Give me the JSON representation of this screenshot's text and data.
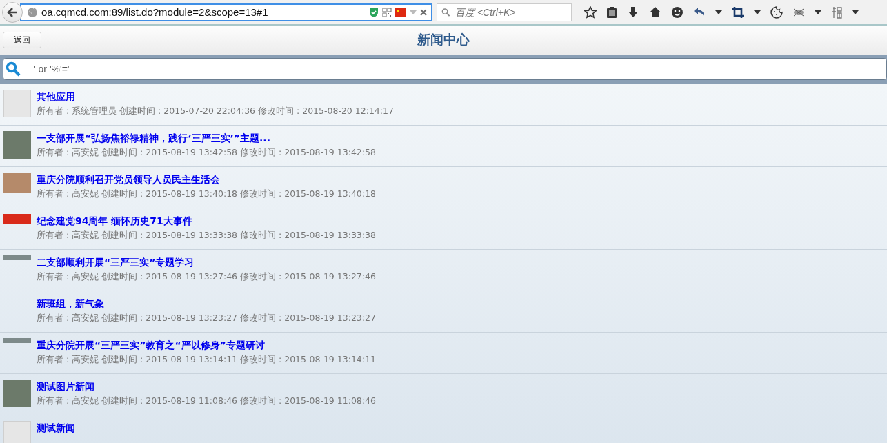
{
  "browser": {
    "url": "oa.cqmcd.com:89/list.do?module=2&scope=13#1",
    "search_placeholder": "百度 <Ctrl+K>"
  },
  "header": {
    "back_button": "返回",
    "title": "新闻中心"
  },
  "search": {
    "value": "—' or '%'='"
  },
  "news": [
    {
      "title": "其他应用",
      "meta": "所有者 : 系统管理员 创建时间 : 2015-07-20 22:04:36 修改时间 : 2015-08-20 12:14:17",
      "kind": "placeholder"
    },
    {
      "title": "一支部开展“弘扬焦裕禄精神，践行‘三严三实’”主题...",
      "meta": "所有者 : 高安妮 创建时间 : 2015-08-19 13:42:58 修改时间 : 2015-08-19 13:42:58",
      "kind": "tall"
    },
    {
      "title": "重庆分院顺利召开党员领导人员民主生活会",
      "meta": "所有者 : 高安妮 创建时间 : 2015-08-19 13:40:18 修改时间 : 2015-08-19 13:40:18",
      "kind": "medium"
    },
    {
      "title": "纪念建党94周年 缅怀历史71大事件",
      "meta": "所有者 : 高安妮 创建时间 : 2015-08-19 13:33:38 修改时间 : 2015-08-19 13:33:38",
      "kind": "banner"
    },
    {
      "title": "二支部顺利开展“三严三实”专题学习",
      "meta": "所有者 : 高安妮 创建时间 : 2015-08-19 13:27:46 修改时间 : 2015-08-19 13:27:46",
      "kind": "strip"
    },
    {
      "title": "新班组，新气象",
      "meta": "所有者 : 高安妮 创建时间 : 2015-08-19 13:23:27 修改时间 : 2015-08-19 13:23:27",
      "kind": "none"
    },
    {
      "title": "重庆分院开展“三严三实”教育之“严以修身”专题研讨",
      "meta": "所有者 : 高安妮 创建时间 : 2015-08-19 13:14:11 修改时间 : 2015-08-19 13:14:11",
      "kind": "strip"
    },
    {
      "title": "测试图片新闻",
      "meta": "所有者 : 高安妮 创建时间 : 2015-08-19 11:08:46 修改时间 : 2015-08-19 11:08:46",
      "kind": "tall"
    },
    {
      "title": "测试新闻",
      "kind": "placeholder"
    }
  ]
}
